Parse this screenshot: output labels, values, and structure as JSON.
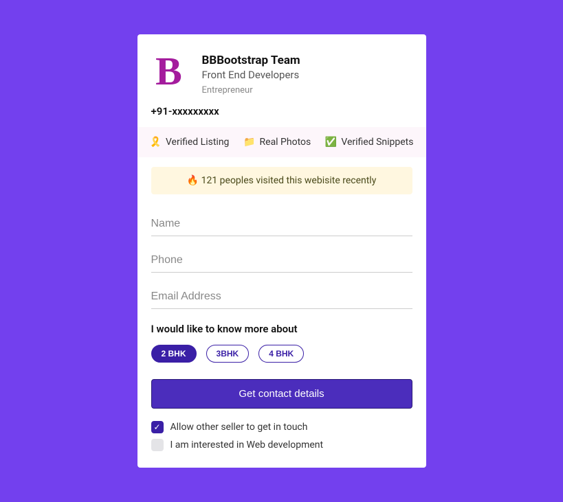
{
  "profile": {
    "avatar_letter": "B",
    "name": "BBBootstrap Team",
    "role": "Front End Developers",
    "tag": "Entrepreneur",
    "phone": "+91-xxxxxxxxx"
  },
  "verification": {
    "items": [
      {
        "icon": "🎗️",
        "label": "Verified Listing"
      },
      {
        "icon": "📁",
        "label": "Real Photos"
      },
      {
        "icon": "✅",
        "label": "Verified Snippets"
      }
    ]
  },
  "alert": {
    "icon": "🔥",
    "text": "121 peoples visited this webisite recently"
  },
  "form": {
    "name_placeholder": "Name",
    "phone_placeholder": "Phone",
    "email_placeholder": "Email Address",
    "question": "I would like to know more about",
    "options": [
      {
        "label": "2 BHK",
        "selected": true
      },
      {
        "label": "3BHK",
        "selected": false
      },
      {
        "label": "4 BHK",
        "selected": false
      }
    ],
    "submit_label": "Get contact details",
    "checkboxes": [
      {
        "label": "Allow other seller to get in touch",
        "checked": true
      },
      {
        "label": "I am interested in Web development",
        "checked": false
      }
    ]
  }
}
